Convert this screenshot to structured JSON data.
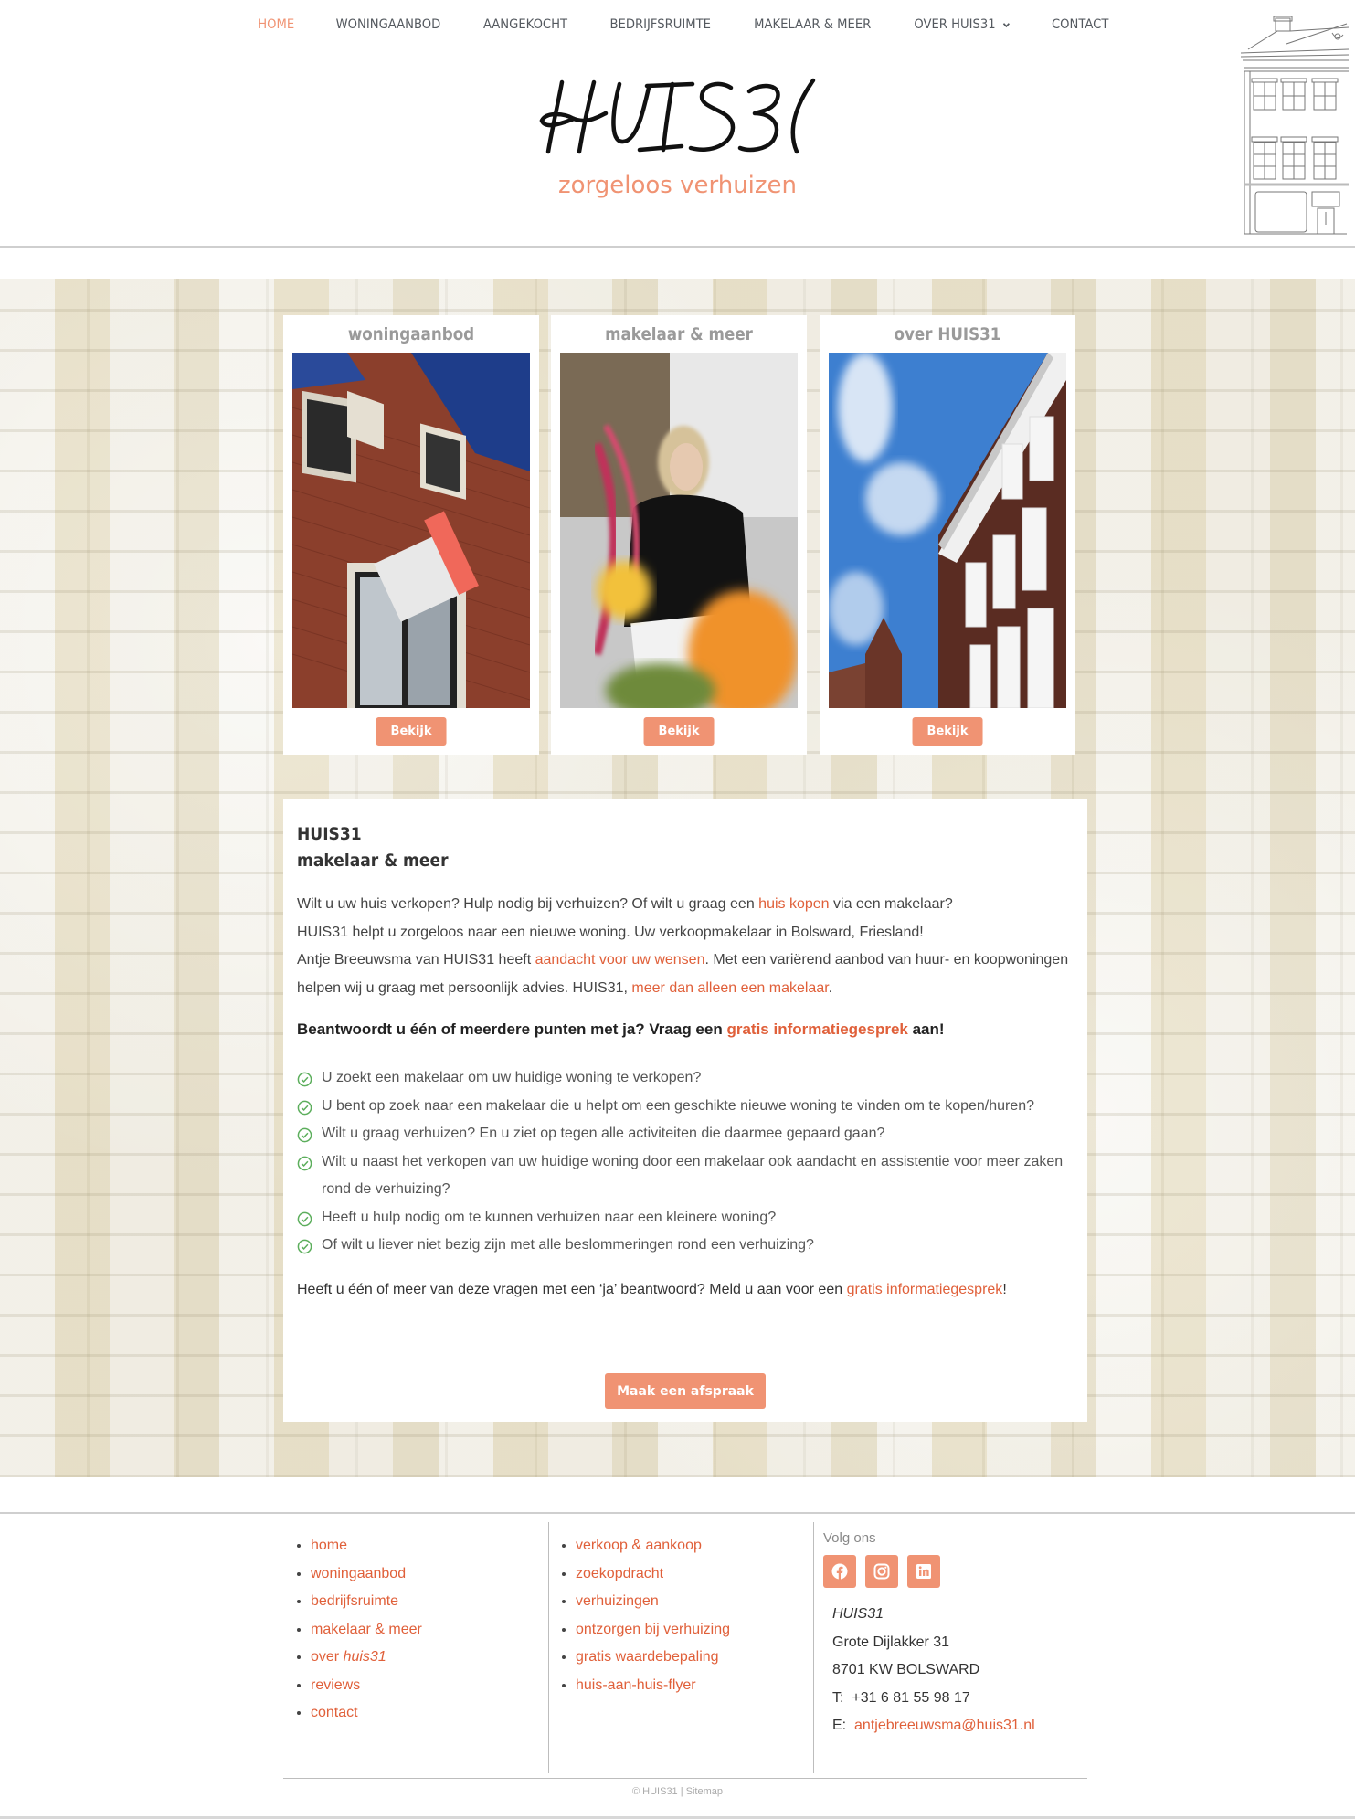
{
  "nav": {
    "items": [
      {
        "label": "HOME",
        "active": true
      },
      {
        "label": "WONINGAANBOD"
      },
      {
        "label": "AANGEKOCHT"
      },
      {
        "label": "BEDRIJFSRUIMTE"
      },
      {
        "label": "MAKELAAR & MEER"
      },
      {
        "label": "OVER HUIS31",
        "has_dropdown": true
      },
      {
        "label": "CONTACT"
      }
    ]
  },
  "header": {
    "logo_text": "HUIS31",
    "tagline": "zorgeloos verhuizen",
    "house_illustration": "house-facade-icon"
  },
  "colors": {
    "accent": "#f09373",
    "link": "#e0603a",
    "check": "#5cae5c",
    "nav_text": "#54595f",
    "card_title": "#9a9a9a"
  },
  "cards": [
    {
      "title": "woningaanbod",
      "button": "Bekijk",
      "image_alt": "Brick house facade with TE KOOP sign"
    },
    {
      "title": "makelaar & meer",
      "button": "Bekijk",
      "image_alt": "Woman writing at a table behind flowers"
    },
    {
      "title": "over HUIS31",
      "button": "Bekijk",
      "image_alt": "Historic brick building with white cornice"
    }
  ],
  "content": {
    "heading_line1": "HUIS31",
    "heading_line2": "makelaar & meer",
    "intro": {
      "p1a": "Wilt u uw huis verkopen? Hulp nodig bij verhuizen? Of wilt u graag een ",
      "p1_link": "huis kopen",
      "p1b": " via een makelaar?",
      "p2": "HUIS31 helpt u zorgeloos naar een nieuwe woning. Uw verkoopmakelaar in Bolsward, Friesland!",
      "p3a": "Antje Breeuwsma van HUIS31 heeft ",
      "p3_link": "aandacht voor uw wensen",
      "p3b": ". Met een variërend aanbod van huur- en koopwoningen helpen wij u graag met persoonlijk advies. HUIS31, ",
      "p3_link2": "meer dan alleen een makelaar",
      "p3c": "."
    },
    "question": {
      "a": "Beantwoordt u één of meerdere punten met ja? Vraag een ",
      "link": "gratis informatiegesprek",
      "b": " aan!"
    },
    "checklist": [
      "U zoekt een makelaar om uw huidige woning te verkopen?",
      "U bent op zoek naar een makelaar die u helpt om een geschikte nieuwe woning te vinden om te kopen/huren?",
      "Wilt u graag verhuizen? En u ziet op tegen alle activiteiten die daarmee gepaard gaan?",
      "Wilt u naast het verkopen van uw huidige woning door een makelaar ook aandacht en assistentie voor meer zaken rond de verhuizing?",
      "Heeft u hulp nodig om te kunnen verhuizen naar een kleinere woning?",
      "Of wilt u liever niet bezig zijn met alle beslommeringen rond een verhuizing?"
    ],
    "outro": {
      "a": "Heeft u één of meer van deze vragen met een ‘ja’ beantwoord? Meld u aan voor een ",
      "link": "gratis informatiegesprek",
      "b": "!"
    },
    "cta": "Maak een afspraak"
  },
  "footer": {
    "col1": [
      "home",
      "woningaanbod",
      "bedrijfsruimte",
      "makelaar & meer",
      "over ",
      "reviews",
      "contact"
    ],
    "col1_italic_suffix": "huis31",
    "col2": [
      "verkoop & aankoop",
      "zoekopdracht",
      "verhuizingen",
      "ontzorgen bij verhuizing",
      "gratis waardebepaling",
      "huis-aan-huis-flyer"
    ],
    "follow_label": "Volg ons",
    "socials": [
      "facebook-icon",
      "instagram-icon",
      "linkedin-icon"
    ],
    "address": {
      "name": "HUIS31",
      "street": "Grote Dijlakker 31",
      "city": "8701 KW BOLSWARD",
      "phone_label": "T:",
      "phone": "+31 6 81 55 98 17",
      "email_label": "E:",
      "email": "antjebreeuwsma@huis31.nl"
    },
    "copyright": "© HUIS31 | Sitemap"
  }
}
